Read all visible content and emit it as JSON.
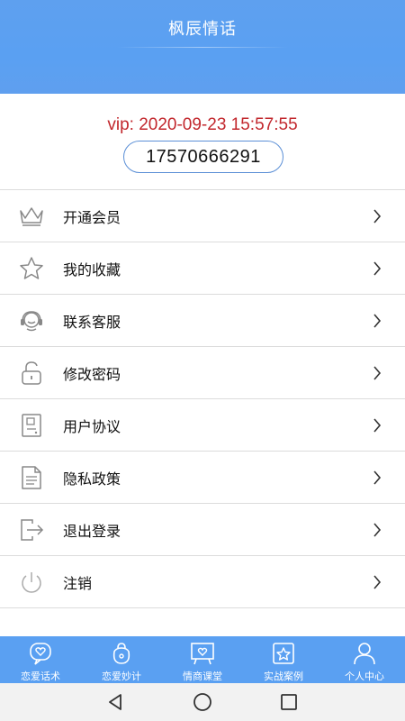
{
  "header": {
    "title": "枫辰情话"
  },
  "profile": {
    "vip_text": "vip: 2020-09-23 15:57:55",
    "phone": "17570666291"
  },
  "menu": {
    "items": [
      {
        "label": "开通会员",
        "icon": "crown-icon"
      },
      {
        "label": "我的收藏",
        "icon": "star-icon"
      },
      {
        "label": "联系客服",
        "icon": "headset-icon"
      },
      {
        "label": "修改密码",
        "icon": "lock-icon"
      },
      {
        "label": "用户协议",
        "icon": "document-icon"
      },
      {
        "label": "隐私政策",
        "icon": "file-icon"
      },
      {
        "label": "退出登录",
        "icon": "logout-icon"
      },
      {
        "label": "注销",
        "icon": "power-icon"
      }
    ]
  },
  "tabbar": {
    "tabs": [
      {
        "label": "恋爱话术",
        "icon": "heart-chat-icon"
      },
      {
        "label": "恋爱妙计",
        "icon": "bag-icon"
      },
      {
        "label": "情商课堂",
        "icon": "board-icon"
      },
      {
        "label": "实战案例",
        "icon": "star-card-icon"
      },
      {
        "label": "个人中心",
        "icon": "person-icon"
      }
    ]
  },
  "colors": {
    "primary": "#5aa0f2",
    "vip_text": "#c2272d",
    "phone_border": "#5b8fd6",
    "icon_gray": "#888888"
  }
}
